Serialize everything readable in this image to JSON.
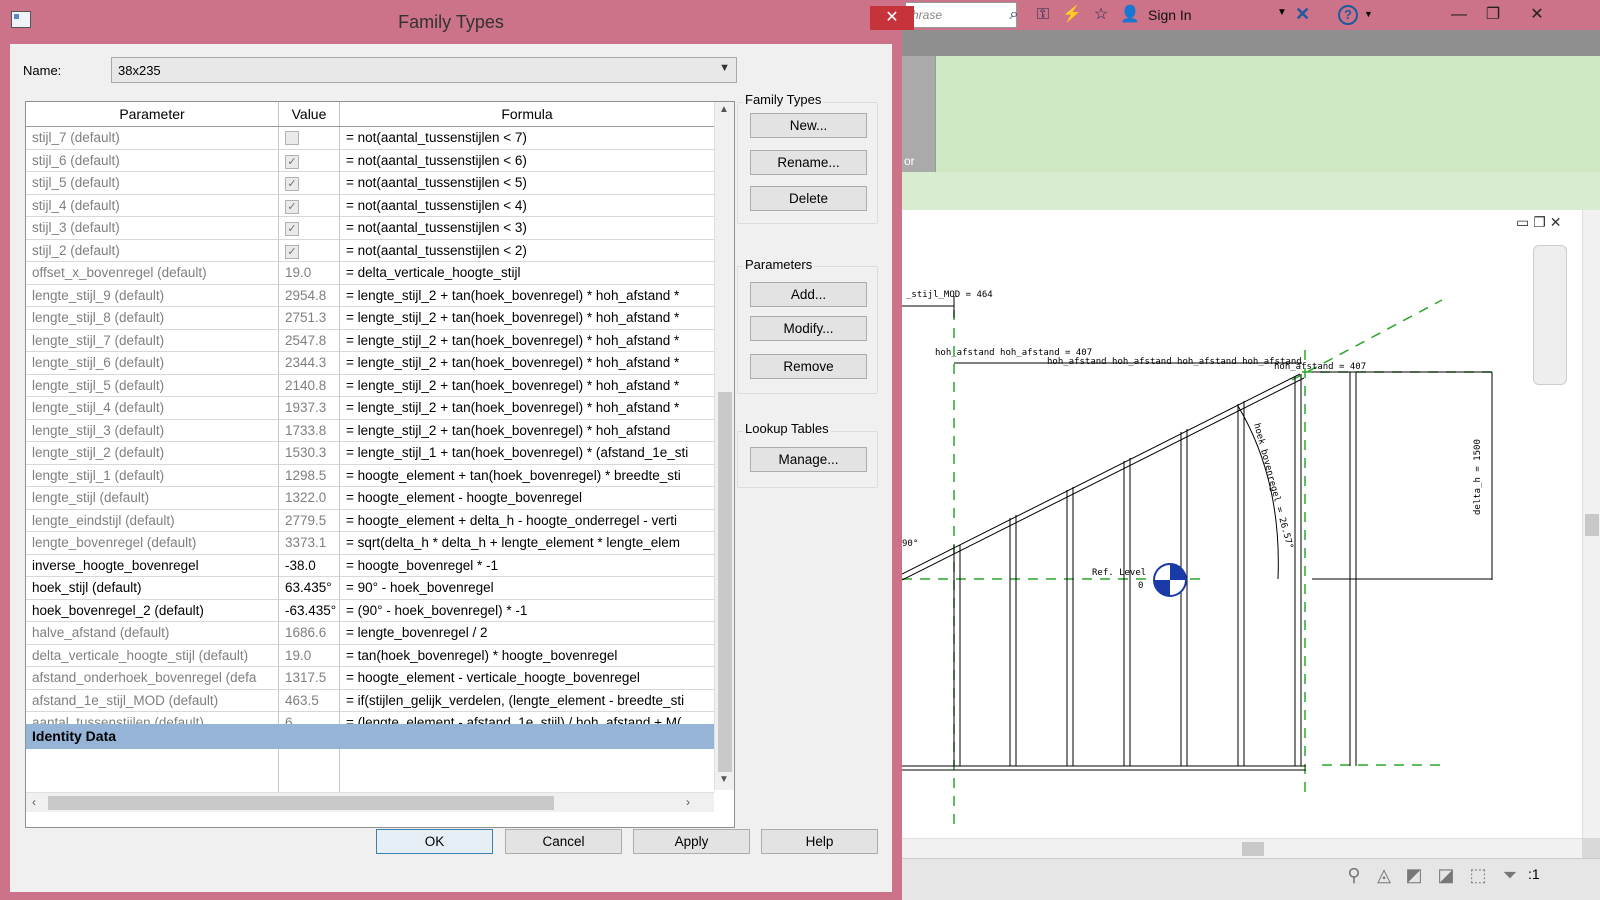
{
  "dialog": {
    "title": "Family Types",
    "name_label": "Name:",
    "name_value": "38x235",
    "columns": [
      "Parameter",
      "Value",
      "Formula"
    ],
    "rows": [
      {
        "param": "stijl_7 (default)",
        "value": "",
        "check": false,
        "formula": "= not(aantal_tussenstijlen < 7)",
        "inst": false
      },
      {
        "param": "stijl_6 (default)",
        "value": "",
        "check": true,
        "formula": "= not(aantal_tussenstijlen < 6)",
        "inst": false
      },
      {
        "param": "stijl_5 (default)",
        "value": "",
        "check": true,
        "formula": "= not(aantal_tussenstijlen < 5)",
        "inst": false
      },
      {
        "param": "stijl_4 (default)",
        "value": "",
        "check": true,
        "formula": "= not(aantal_tussenstijlen < 4)",
        "inst": false
      },
      {
        "param": "stijl_3 (default)",
        "value": "",
        "check": true,
        "formula": "= not(aantal_tussenstijlen < 3)",
        "inst": false
      },
      {
        "param": "stijl_2 (default)",
        "value": "",
        "check": true,
        "formula": "= not(aantal_tussenstijlen < 2)",
        "inst": false
      },
      {
        "param": "offset_x_bovenregel (default)",
        "value": "19.0",
        "formula": "= delta_verticale_hoogte_stijl",
        "inst": false
      },
      {
        "param": "lengte_stijl_9 (default)",
        "value": "2954.8",
        "formula": "= lengte_stijl_2 + tan(hoek_bovenregel) * hoh_afstand *",
        "inst": false
      },
      {
        "param": "lengte_stijl_8 (default)",
        "value": "2751.3",
        "formula": "= lengte_stijl_2 + tan(hoek_bovenregel) * hoh_afstand *",
        "inst": false
      },
      {
        "param": "lengte_stijl_7 (default)",
        "value": "2547.8",
        "formula": "= lengte_stijl_2 + tan(hoek_bovenregel) * hoh_afstand *",
        "inst": false
      },
      {
        "param": "lengte_stijl_6 (default)",
        "value": "2344.3",
        "formula": "= lengte_stijl_2 + tan(hoek_bovenregel) * hoh_afstand *",
        "inst": false
      },
      {
        "param": "lengte_stijl_5 (default)",
        "value": "2140.8",
        "formula": "= lengte_stijl_2 + tan(hoek_bovenregel) * hoh_afstand *",
        "inst": false
      },
      {
        "param": "lengte_stijl_4 (default)",
        "value": "1937.3",
        "formula": "= lengte_stijl_2 + tan(hoek_bovenregel) * hoh_afstand *",
        "inst": false
      },
      {
        "param": "lengte_stijl_3 (default)",
        "value": "1733.8",
        "formula": "= lengte_stijl_2 + tan(hoek_bovenregel) * hoh_afstand",
        "inst": false
      },
      {
        "param": "lengte_stijl_2 (default)",
        "value": "1530.3",
        "formula": "= lengte_stijl_1 + tan(hoek_bovenregel) * (afstand_1e_sti",
        "inst": false
      },
      {
        "param": "lengte_stijl_1 (default)",
        "value": "1298.5",
        "formula": "= hoogte_element + tan(hoek_bovenregel) * breedte_sti",
        "inst": false
      },
      {
        "param": "lengte_stijl (default)",
        "value": "1322.0",
        "formula": "= hoogte_element - hoogte_bovenregel",
        "inst": false
      },
      {
        "param": "lengte_eindstijl (default)",
        "value": "2779.5",
        "formula": "= hoogte_element + delta_h - hoogte_onderregel - verti",
        "inst": false
      },
      {
        "param": "lengte_bovenregel (default)",
        "value": "3373.1",
        "formula": "= sqrt(delta_h * delta_h + lengte_element * lengte_elem",
        "inst": false
      },
      {
        "param": "inverse_hoogte_bovenregel",
        "value": "-38.0",
        "formula": "= hoogte_bovenregel * -1",
        "inst": true
      },
      {
        "param": "hoek_stijl (default)",
        "value": "63.435°",
        "formula": "= 90° - hoek_bovenregel",
        "inst": true
      },
      {
        "param": "hoek_bovenregel_2 (default)",
        "value": "-63.435°",
        "formula": "= (90° - hoek_bovenregel) * -1",
        "inst": true
      },
      {
        "param": "halve_afstand (default)",
        "value": "1686.6",
        "formula": "= lengte_bovenregel / 2",
        "inst": false
      },
      {
        "param": "delta_verticale_hoogte_stijl (default)",
        "value": "19.0",
        "formula": "= tan(hoek_bovenregel) * hoogte_bovenregel",
        "inst": false
      },
      {
        "param": "afstand_onderhoek_bovenregel (defa",
        "value": "1317.5",
        "formula": "= hoogte_element - verticale_hoogte_bovenregel",
        "inst": false
      },
      {
        "param": "afstand_1e_stijl_MOD (default)",
        "value": "463.5",
        "formula": "= if(stijlen_gelijk_verdelen, (lengte_element - breedte_sti",
        "inst": false
      },
      {
        "param": "aantal_tussenstijlen (default)",
        "value": "6",
        "formula": "= (lengte_element - afstand_1e_stijl) / hoh_afstand + M(",
        "inst": false
      }
    ],
    "identity_group": "Identity Data",
    "family_types_group": "Family Types",
    "new_btn": "New...",
    "rename_btn": "Rename...",
    "delete_btn": "Delete",
    "parameters_group": "Parameters",
    "add_btn": "Add...",
    "modify_btn": "Modify...",
    "remove_btn": "Remove",
    "lookup_group": "Lookup Tables",
    "manage_btn": "Manage...",
    "ok_btn": "OK",
    "cancel_btn": "Cancel",
    "apply_btn": "Apply",
    "help_btn": "Help"
  },
  "app": {
    "search_placeholder": "hrase",
    "sign_in": "Sign In",
    "tab_label": "or",
    "status_filter": ":1"
  },
  "drawing": {
    "label_mod": "_stijl_MOD = 464",
    "label_hoh1": "hoh_afstand hoh_afstand = 407",
    "label_hoh2": "hoh_afstand hoh_afstand hoh_afstand hoh_afstand",
    "label_hoh3": "hoh_afstand = 407",
    "label_angle": "hoek_bovenregel = 26.57°",
    "label_delta": "delta_h = 1500",
    "label_ref": "Ref. Level",
    "label_zero": "0",
    "label_deg": "90°"
  },
  "colors": {
    "titlebar": "#cc7289",
    "identity_row": "#96b4d7",
    "close_button": "#c6333a",
    "ref_lines": "#2aa52a"
  }
}
